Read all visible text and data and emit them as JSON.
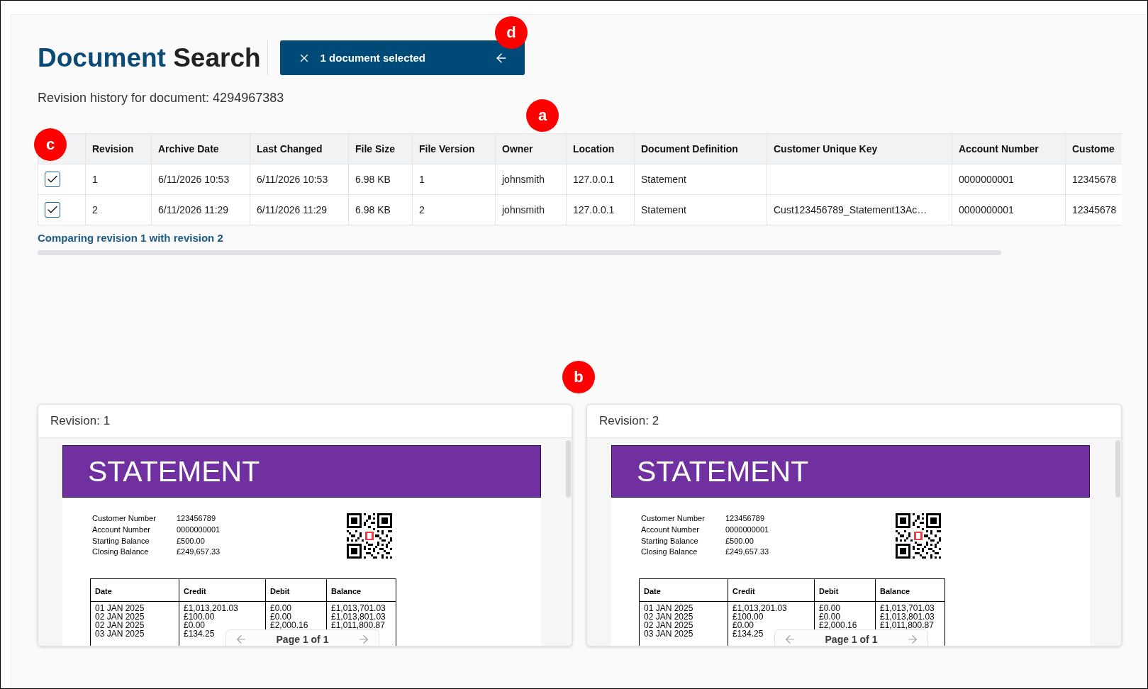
{
  "header": {
    "title": {
      "lead": "Document",
      "rest": "Search"
    },
    "selection_bar": {
      "label": "1 document selected"
    }
  },
  "subtitle": "Revision history for document: 4294967383",
  "table": {
    "columns": [
      "Revision",
      "Archive Date",
      "Last Changed",
      "File Size",
      "File Version",
      "Owner",
      "Location",
      "Document Definition",
      "Customer Unique Key",
      "Account Number",
      "Custome"
    ],
    "rows": [
      {
        "checked": true,
        "cells": [
          "1",
          "6/11/2026 10:53",
          "6/11/2026 10:53",
          "6.98 KB",
          "1",
          "johnsmith",
          "127.0.0.1",
          "Statement",
          null,
          "0000000001",
          "12345678"
        ]
      },
      {
        "checked": true,
        "cells": [
          "2",
          "6/11/2026 11:29",
          "6/11/2026 11:29",
          "6.98 KB",
          "2",
          "johnsmith",
          "127.0.0.1",
          "Statement",
          "Cust123456789_Statement13Ac…",
          "0000000001",
          "12345678"
        ]
      }
    ]
  },
  "comparison_note": "Comparing revision 1 with revision 2",
  "panels": [
    {
      "title": "Revision: 1",
      "document": {
        "banner": "STATEMENT",
        "details": [
          {
            "label": "Customer Number",
            "value": "123456789"
          },
          {
            "label": "Account Number",
            "value": "0000000001"
          },
          {
            "label": "Starting Balance",
            "value": "£500.00"
          },
          {
            "label": "Closing Balance",
            "value": "£249,657.33"
          }
        ],
        "table": {
          "columns": [
            "Date",
            "Credit",
            "Debit",
            "Balance"
          ],
          "rows": [
            [
              "01 JAN 2025",
              "£1,013,201.03",
              "£0.00",
              "£1,013,701.03"
            ],
            [
              "02 JAN 2025",
              "£100.00",
              "£0.00",
              "£1,013,801.03"
            ],
            [
              "02 JAN 2025",
              "£0.00",
              "£2,000.16",
              "£1,011,800.87"
            ],
            [
              "03 JAN 2025",
              "£134.25",
              null,
              null
            ]
          ]
        }
      },
      "pager": {
        "label": "Page 1 of 1"
      }
    },
    {
      "title": "Revision: 2",
      "document": {
        "banner": "STATEMENT",
        "details": [
          {
            "label": "Customer Number",
            "value": "123456789"
          },
          {
            "label": "Account Number",
            "value": "0000000001"
          },
          {
            "label": "Starting Balance",
            "value": "£500.00"
          },
          {
            "label": "Closing Balance",
            "value": "£249,657.33"
          }
        ],
        "table": {
          "columns": [
            "Date",
            "Credit",
            "Debit",
            "Balance"
          ],
          "rows": [
            [
              "01 JAN 2025",
              "£1,013,201.03",
              "£0.00",
              "£1,013,701.03"
            ],
            [
              "02 JAN 2025",
              "£100.00",
              "£0.00",
              "£1,013,801.03"
            ],
            [
              "02 JAN 2025",
              "£0.00",
              "£2,000.16",
              "£1,011,800.87"
            ],
            [
              "03 JAN 2025",
              "£134.25",
              null,
              null
            ]
          ]
        }
      },
      "pager": {
        "label": "Page 1 of 1"
      }
    }
  ],
  "callouts": [
    {
      "label": "d"
    },
    {
      "label": "a"
    },
    {
      "label": "c"
    },
    {
      "label": "b"
    }
  ]
}
